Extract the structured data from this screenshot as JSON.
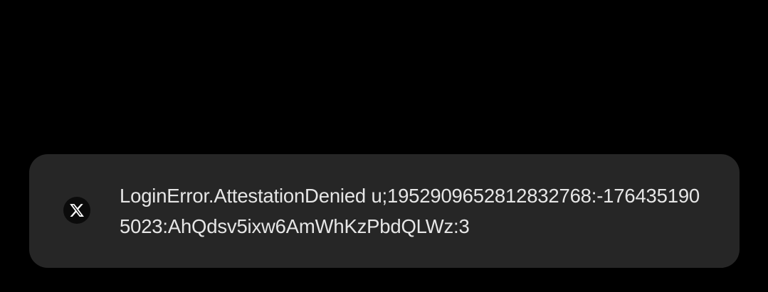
{
  "toast": {
    "app_icon": "x-logo-icon",
    "message": "LoginError.AttestationDenied u;1952909652812832768:-1764351905023:AhQdsv5ixw6AmWhKzPbdQLWz:3"
  },
  "colors": {
    "background": "#000000",
    "toast_background": "#262626",
    "text": "#e6e6e6",
    "icon_background": "#0b0b0b",
    "icon_glyph": "#ffffff"
  }
}
